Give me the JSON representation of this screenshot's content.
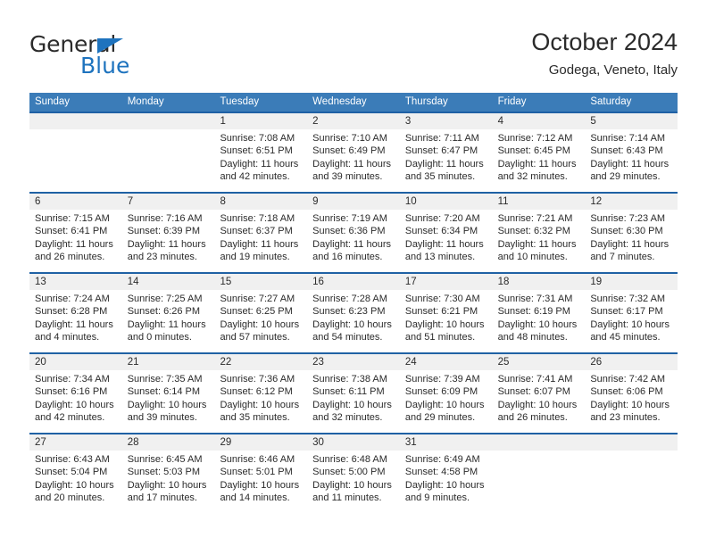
{
  "brand": {
    "word_one": "General",
    "word_two": "Blue",
    "accent_color": "#1e73be",
    "triangle_icon": "triangle-icon"
  },
  "header": {
    "title": "October 2024",
    "subtitle": "Godega, Veneto, Italy"
  },
  "calendar": {
    "header_bg": "#3b7cb8",
    "week_separator_color": "#1f61a4",
    "daynum_band_bg": "#f0f0f0",
    "weekdays": [
      "Sunday",
      "Monday",
      "Tuesday",
      "Wednesday",
      "Thursday",
      "Friday",
      "Saturday"
    ],
    "weeks": [
      [
        {
          "day": "",
          "sunrise": "",
          "sunset": "",
          "daylight_1": "",
          "daylight_2": ""
        },
        {
          "day": "",
          "sunrise": "",
          "sunset": "",
          "daylight_1": "",
          "daylight_2": ""
        },
        {
          "day": "1",
          "sunrise": "Sunrise: 7:08 AM",
          "sunset": "Sunset: 6:51 PM",
          "daylight_1": "Daylight: 11 hours",
          "daylight_2": "and 42 minutes."
        },
        {
          "day": "2",
          "sunrise": "Sunrise: 7:10 AM",
          "sunset": "Sunset: 6:49 PM",
          "daylight_1": "Daylight: 11 hours",
          "daylight_2": "and 39 minutes."
        },
        {
          "day": "3",
          "sunrise": "Sunrise: 7:11 AM",
          "sunset": "Sunset: 6:47 PM",
          "daylight_1": "Daylight: 11 hours",
          "daylight_2": "and 35 minutes."
        },
        {
          "day": "4",
          "sunrise": "Sunrise: 7:12 AM",
          "sunset": "Sunset: 6:45 PM",
          "daylight_1": "Daylight: 11 hours",
          "daylight_2": "and 32 minutes."
        },
        {
          "day": "5",
          "sunrise": "Sunrise: 7:14 AM",
          "sunset": "Sunset: 6:43 PM",
          "daylight_1": "Daylight: 11 hours",
          "daylight_2": "and 29 minutes."
        }
      ],
      [
        {
          "day": "6",
          "sunrise": "Sunrise: 7:15 AM",
          "sunset": "Sunset: 6:41 PM",
          "daylight_1": "Daylight: 11 hours",
          "daylight_2": "and 26 minutes."
        },
        {
          "day": "7",
          "sunrise": "Sunrise: 7:16 AM",
          "sunset": "Sunset: 6:39 PM",
          "daylight_1": "Daylight: 11 hours",
          "daylight_2": "and 23 minutes."
        },
        {
          "day": "8",
          "sunrise": "Sunrise: 7:18 AM",
          "sunset": "Sunset: 6:37 PM",
          "daylight_1": "Daylight: 11 hours",
          "daylight_2": "and 19 minutes."
        },
        {
          "day": "9",
          "sunrise": "Sunrise: 7:19 AM",
          "sunset": "Sunset: 6:36 PM",
          "daylight_1": "Daylight: 11 hours",
          "daylight_2": "and 16 minutes."
        },
        {
          "day": "10",
          "sunrise": "Sunrise: 7:20 AM",
          "sunset": "Sunset: 6:34 PM",
          "daylight_1": "Daylight: 11 hours",
          "daylight_2": "and 13 minutes."
        },
        {
          "day": "11",
          "sunrise": "Sunrise: 7:21 AM",
          "sunset": "Sunset: 6:32 PM",
          "daylight_1": "Daylight: 11 hours",
          "daylight_2": "and 10 minutes."
        },
        {
          "day": "12",
          "sunrise": "Sunrise: 7:23 AM",
          "sunset": "Sunset: 6:30 PM",
          "daylight_1": "Daylight: 11 hours",
          "daylight_2": "and 7 minutes."
        }
      ],
      [
        {
          "day": "13",
          "sunrise": "Sunrise: 7:24 AM",
          "sunset": "Sunset: 6:28 PM",
          "daylight_1": "Daylight: 11 hours",
          "daylight_2": "and 4 minutes."
        },
        {
          "day": "14",
          "sunrise": "Sunrise: 7:25 AM",
          "sunset": "Sunset: 6:26 PM",
          "daylight_1": "Daylight: 11 hours",
          "daylight_2": "and 0 minutes."
        },
        {
          "day": "15",
          "sunrise": "Sunrise: 7:27 AM",
          "sunset": "Sunset: 6:25 PM",
          "daylight_1": "Daylight: 10 hours",
          "daylight_2": "and 57 minutes."
        },
        {
          "day": "16",
          "sunrise": "Sunrise: 7:28 AM",
          "sunset": "Sunset: 6:23 PM",
          "daylight_1": "Daylight: 10 hours",
          "daylight_2": "and 54 minutes."
        },
        {
          "day": "17",
          "sunrise": "Sunrise: 7:30 AM",
          "sunset": "Sunset: 6:21 PM",
          "daylight_1": "Daylight: 10 hours",
          "daylight_2": "and 51 minutes."
        },
        {
          "day": "18",
          "sunrise": "Sunrise: 7:31 AM",
          "sunset": "Sunset: 6:19 PM",
          "daylight_1": "Daylight: 10 hours",
          "daylight_2": "and 48 minutes."
        },
        {
          "day": "19",
          "sunrise": "Sunrise: 7:32 AM",
          "sunset": "Sunset: 6:17 PM",
          "daylight_1": "Daylight: 10 hours",
          "daylight_2": "and 45 minutes."
        }
      ],
      [
        {
          "day": "20",
          "sunrise": "Sunrise: 7:34 AM",
          "sunset": "Sunset: 6:16 PM",
          "daylight_1": "Daylight: 10 hours",
          "daylight_2": "and 42 minutes."
        },
        {
          "day": "21",
          "sunrise": "Sunrise: 7:35 AM",
          "sunset": "Sunset: 6:14 PM",
          "daylight_1": "Daylight: 10 hours",
          "daylight_2": "and 39 minutes."
        },
        {
          "day": "22",
          "sunrise": "Sunrise: 7:36 AM",
          "sunset": "Sunset: 6:12 PM",
          "daylight_1": "Daylight: 10 hours",
          "daylight_2": "and 35 minutes."
        },
        {
          "day": "23",
          "sunrise": "Sunrise: 7:38 AM",
          "sunset": "Sunset: 6:11 PM",
          "daylight_1": "Daylight: 10 hours",
          "daylight_2": "and 32 minutes."
        },
        {
          "day": "24",
          "sunrise": "Sunrise: 7:39 AM",
          "sunset": "Sunset: 6:09 PM",
          "daylight_1": "Daylight: 10 hours",
          "daylight_2": "and 29 minutes."
        },
        {
          "day": "25",
          "sunrise": "Sunrise: 7:41 AM",
          "sunset": "Sunset: 6:07 PM",
          "daylight_1": "Daylight: 10 hours",
          "daylight_2": "and 26 minutes."
        },
        {
          "day": "26",
          "sunrise": "Sunrise: 7:42 AM",
          "sunset": "Sunset: 6:06 PM",
          "daylight_1": "Daylight: 10 hours",
          "daylight_2": "and 23 minutes."
        }
      ],
      [
        {
          "day": "27",
          "sunrise": "Sunrise: 6:43 AM",
          "sunset": "Sunset: 5:04 PM",
          "daylight_1": "Daylight: 10 hours",
          "daylight_2": "and 20 minutes."
        },
        {
          "day": "28",
          "sunrise": "Sunrise: 6:45 AM",
          "sunset": "Sunset: 5:03 PM",
          "daylight_1": "Daylight: 10 hours",
          "daylight_2": "and 17 minutes."
        },
        {
          "day": "29",
          "sunrise": "Sunrise: 6:46 AM",
          "sunset": "Sunset: 5:01 PM",
          "daylight_1": "Daylight: 10 hours",
          "daylight_2": "and 14 minutes."
        },
        {
          "day": "30",
          "sunrise": "Sunrise: 6:48 AM",
          "sunset": "Sunset: 5:00 PM",
          "daylight_1": "Daylight: 10 hours",
          "daylight_2": "and 11 minutes."
        },
        {
          "day": "31",
          "sunrise": "Sunrise: 6:49 AM",
          "sunset": "Sunset: 4:58 PM",
          "daylight_1": "Daylight: 10 hours",
          "daylight_2": "and 9 minutes."
        },
        {
          "day": "",
          "sunrise": "",
          "sunset": "",
          "daylight_1": "",
          "daylight_2": ""
        },
        {
          "day": "",
          "sunrise": "",
          "sunset": "",
          "daylight_1": "",
          "daylight_2": ""
        }
      ]
    ]
  }
}
